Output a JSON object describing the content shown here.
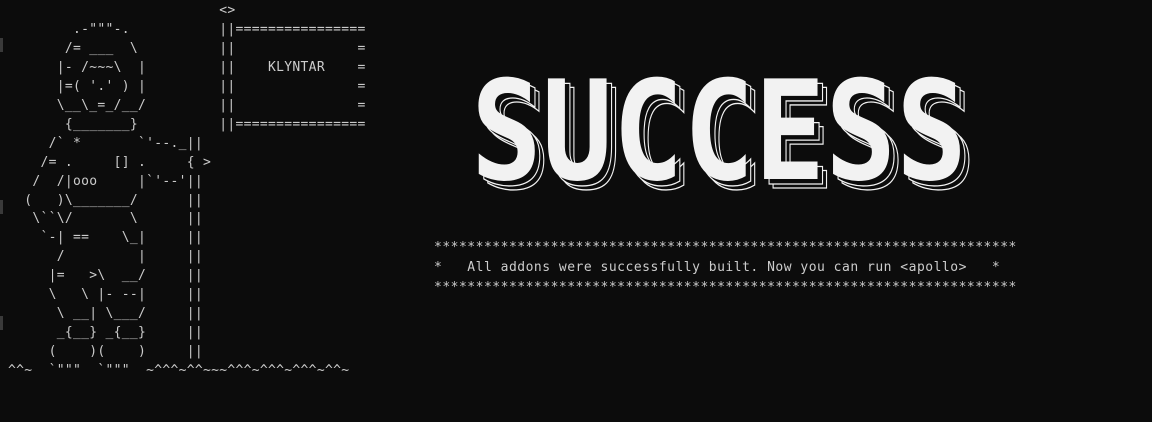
{
  "terminal": {
    "background": "#0c0c0c",
    "foreground": "#cccccc",
    "banner_color": "#f2f2f2"
  },
  "ascii_art": "                          <>\n        .-\"\"\"-.           ||================\n       /= ___  \\          ||               =\n      |- /~~~\\  |         ||    KLYNTAR    =\n      |=( '.' ) |         ||               =\n      \\__\\_=_/__/         ||               =\n       {_______}          ||================\n     /` *       `'--._||\n    /= .     [] .     { >\n   /  /|ooo     |`'--'||\n  (   )\\_______/      ||\n   \\``\\/       \\      ||\n    `-| ==    \\_|     ||\n      /         |     ||\n     |=   >\\  __/     ||\n     \\   \\ |- --|     ||\n      \\ __| \\___/     ||\n      _{__} _{__}     ||\n     (    )(    )     ||\n^^~  `\"\"\"  `\"\"\"  ~^^^~^^~~~^^^~^^^~^^^~^^~",
  "banner": {
    "text": "SUCCESS"
  },
  "message": {
    "border_top": "**********************************************************************",
    "line": "*   All addons were successfully built. Now you can run <apollo>   *",
    "border_bottom": "**********************************************************************"
  }
}
